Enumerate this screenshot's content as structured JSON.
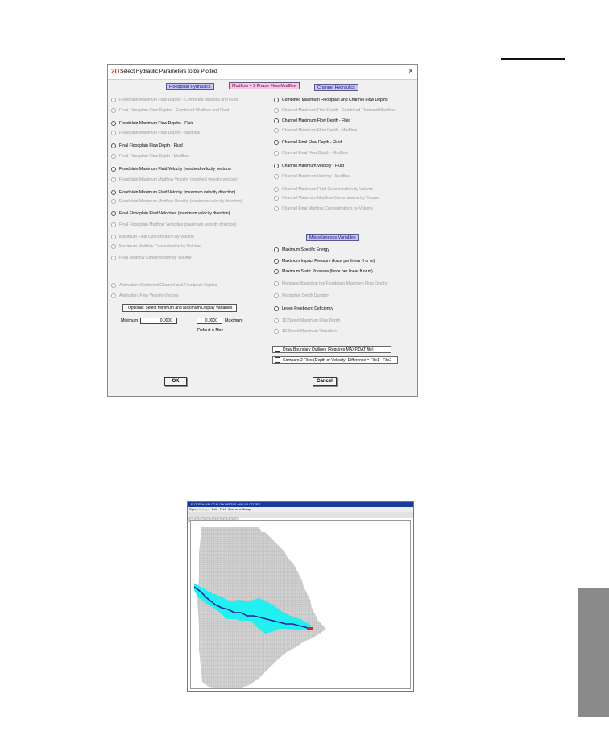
{
  "dialog": {
    "title": "Select Hydraulic Parameters to be Plotted",
    "close": "×",
    "headers": {
      "floodplain": "Floodplain Hydraulics",
      "mudflow": "Mudflow + 2 Phase Flow Mudflow",
      "channel": "Channel Hydraulics",
      "misc": "Miscellaneous Variables"
    },
    "left_options": [
      "Floodplain Maximum Flow Depths - Combined Mudflow and Fluid",
      "Final Floodplain Flow Depths - Combined Mudflow and Fluid",
      "Floodplain Maximum Flow Depths - Fluid",
      "Floodplain Maximum Flow Depths - Mudflow",
      "Final Floodplain Flow Depth - Fluid",
      "Final Floodplain Flow Depth - Mudflow",
      "Floodplain Maximum Fluid Velocity (resolved velocity vectors)",
      "Floodplain Maximum Mudflow Velocity (resolved velocity vectors)",
      "Floodplain Maximum Fluid Velocity (maximum velocity direction)",
      "Floodplain Maximum Mudflow Velocity (maximum velocity direction)",
      "Final Floodplain Fluid Velocities (maximum velocity direction)",
      "Final Floodplain Mudflow Velocities (maximum velocity direction)",
      "Maximum Fluid Concentration by Volume",
      "Maximum Mudflow Concentration by Volume",
      "Final Mudflow Concentration by Volume",
      "Animation: Combined Channel and Floodplain Depths",
      "Animation: Flow Velocity Vectors"
    ],
    "right_options": [
      "Combined Maximum Floodplain and Channel Flow Depths",
      "Channel Maximum Flow Depth - Combined Fluid and Mudflow",
      "Channel Maximum Flow Depth - Fluid",
      "Channel Maximum Flow Depth - Mudflow",
      "Channel Final Flow Depth - Fluid",
      "Channel Final Flow Depth - Mudflow",
      "Channel Maximum Velocity - Fluid",
      "Channel Maximum Velocity - Mudflow",
      "Channel Maximum Fluid Concentration by Volume",
      "Channel Maximum Mudflow Concentration by Volume",
      "Channel Final Mudflow Concentrations by Volume"
    ],
    "misc_options": [
      "Maximum Specific Energy",
      "Maximum Impact Pressure (force per linear ft or m)",
      "Maximum Static Pressure (force per linear ft or m)",
      "Floodway Based on the Floodplain Maximum Flow Depths",
      "Floodplain Depth Duration",
      "Levee Freeboard Deficiency",
      "1D Street Maximum Flow Depth",
      "1D Street Maximum Velocities"
    ],
    "optional": {
      "label": "Optional: Select Minimum and Maximum Display Variables",
      "min_label": "Minimum",
      "min_value": "0.0000",
      "max_value": "0.0000",
      "max_label": "Maximum",
      "default_note": "Default = Max"
    },
    "checkboxes": {
      "boundary": "Draw Boundary Outlines (Requires MAXP.DAT file)",
      "compare": "Compare 2 Files (Depth or Velocity)  Difference = File1 - File2"
    },
    "ok": "OK",
    "cancel": "Cancel"
  },
  "plot_window": {
    "title": "FLO-2D MAXPLOT FLOW DEPTHS AND VELOCITIES",
    "menu": [
      "Open",
      "Settings",
      "Exit",
      "Print",
      "Save as a Bitmap"
    ],
    "colors": {
      "grid": "#c8c8c8",
      "flood": "#22f0f0",
      "channel": "#2020a0",
      "outlet": "#e02020"
    }
  }
}
